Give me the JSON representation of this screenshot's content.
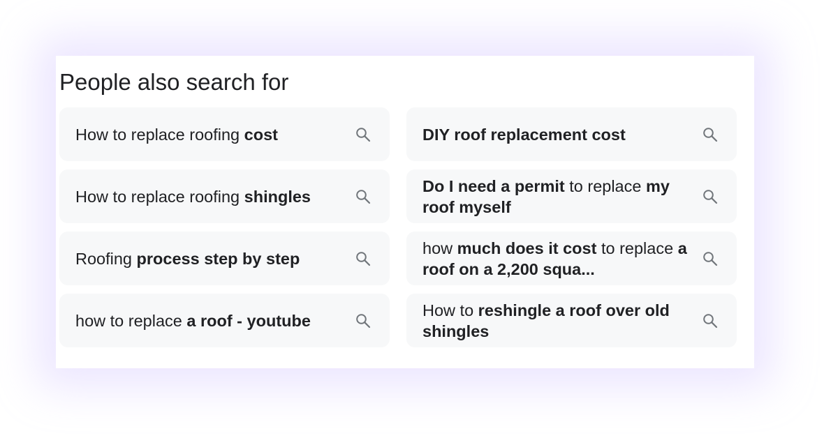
{
  "section": {
    "title": "People also search for"
  },
  "colors": {
    "chip_background": "#f7f8f9",
    "text": "#202124",
    "icon": "#70757a",
    "glow": "#cdbeff"
  },
  "icons": {
    "search": "search-icon"
  },
  "suggestions": [
    {
      "parts": [
        {
          "text": "How to replace roofing ",
          "bold": false
        },
        {
          "text": "cost",
          "bold": true
        }
      ]
    },
    {
      "parts": [
        {
          "text": "DIY roof replacement cost",
          "bold": true
        }
      ]
    },
    {
      "parts": [
        {
          "text": "How to replace roofing ",
          "bold": false
        },
        {
          "text": "shingles",
          "bold": true
        }
      ]
    },
    {
      "parts": [
        {
          "text": "Do I need a permit",
          "bold": true
        },
        {
          "text": " to replace ",
          "bold": false
        },
        {
          "text": "my roof myself",
          "bold": true
        }
      ]
    },
    {
      "parts": [
        {
          "text": "Roofing ",
          "bold": false
        },
        {
          "text": "process step by step",
          "bold": true
        }
      ]
    },
    {
      "parts": [
        {
          "text": "how ",
          "bold": false
        },
        {
          "text": "much does it cost",
          "bold": true
        },
        {
          "text": " to replace ",
          "bold": false
        },
        {
          "text": "a roof on a 2,200 squa...",
          "bold": true
        }
      ]
    },
    {
      "parts": [
        {
          "text": "how to replace ",
          "bold": false
        },
        {
          "text": "a roof - youtube",
          "bold": true
        }
      ]
    },
    {
      "parts": [
        {
          "text": "How to ",
          "bold": false
        },
        {
          "text": "reshingle a roof over old shingles",
          "bold": true
        }
      ]
    }
  ]
}
